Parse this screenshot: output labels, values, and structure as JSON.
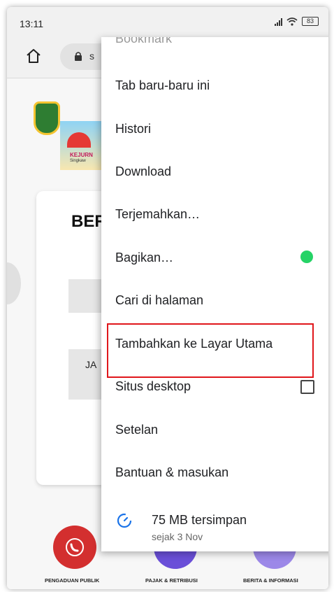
{
  "status_bar": {
    "time": "13:11",
    "battery": "83"
  },
  "url_bar": {
    "url_fragment": "s"
  },
  "page": {
    "heading_fragment": "BER",
    "box_text_fragment": "JA",
    "banner_line1": "KEJURN",
    "banner_line2": "Singkaw",
    "bottom_nav": [
      {
        "label": "PENGADUAN PUBLIK",
        "color": "#d32f2f"
      },
      {
        "label": "PAJAK & RETRIBUSI",
        "color": "#6a4fd8"
      },
      {
        "label": "BERITA & INFORMASI",
        "color": "#9c88e8"
      }
    ]
  },
  "menu": {
    "items": [
      {
        "label": "Bookmark",
        "partial": true
      },
      {
        "label": "Tab baru-baru ini"
      },
      {
        "label": "Histori"
      },
      {
        "label": "Download"
      },
      {
        "label": "Terjemahkan…"
      },
      {
        "label": "Bagikan…",
        "trailing_icon": "whatsapp-icon"
      },
      {
        "label": "Cari di halaman"
      },
      {
        "label": "Tambahkan ke Layar Utama",
        "highlighted": true
      },
      {
        "label": "Situs desktop",
        "trailing_control": "checkbox",
        "checked": false
      },
      {
        "label": "Setelan"
      },
      {
        "label": "Bantuan & masukan"
      }
    ],
    "data_saved": {
      "amount": "75 MB tersimpan",
      "since": "sejak 3 Nov",
      "icon": "speedometer-icon"
    }
  },
  "colors": {
    "highlight_border": "#e0161b",
    "accent_blue": "#1a73e8",
    "whatsapp_green": "#25d366"
  }
}
